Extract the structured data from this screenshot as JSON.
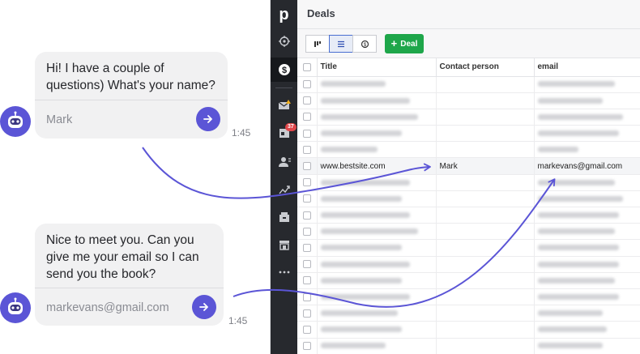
{
  "chat": {
    "messages": [
      {
        "text_line1": "Hi! I have a couple of",
        "text_line2": "questions) What's your name?",
        "input_value": "Mark",
        "time": "1:45"
      },
      {
        "text_line1": "Nice to meet you. Can you",
        "text_line2": "give me your email so I can",
        "text_line3": "send you the book?",
        "input_value": "markevans@gmail.com",
        "time": "1:45"
      }
    ],
    "accent_color": "#5b55d6",
    "avatar_icon": "robot-icon",
    "send_icon": "arrow-right-icon"
  },
  "crm": {
    "logo_letter": "p",
    "page_title": "Deals",
    "add_deal_label": "Deal",
    "add_deal_icon": "plus-icon",
    "view_icons": [
      "pipeline-view-icon",
      "list-view-icon",
      "forecast-view-icon"
    ],
    "rail_icons": [
      "target-icon",
      "dollar-icon",
      "mail-icon",
      "calendar-icon",
      "contacts-icon",
      "trending-icon",
      "products-icon",
      "store-icon",
      "more-icon"
    ],
    "calendar_badge": "37",
    "columns": {
      "title": "Title",
      "contact": "Contact person",
      "email": "email"
    },
    "highlighted_row": {
      "title": "www.bestsite.com",
      "contact": "Mark",
      "email": "markevans@gmail.com"
    }
  }
}
